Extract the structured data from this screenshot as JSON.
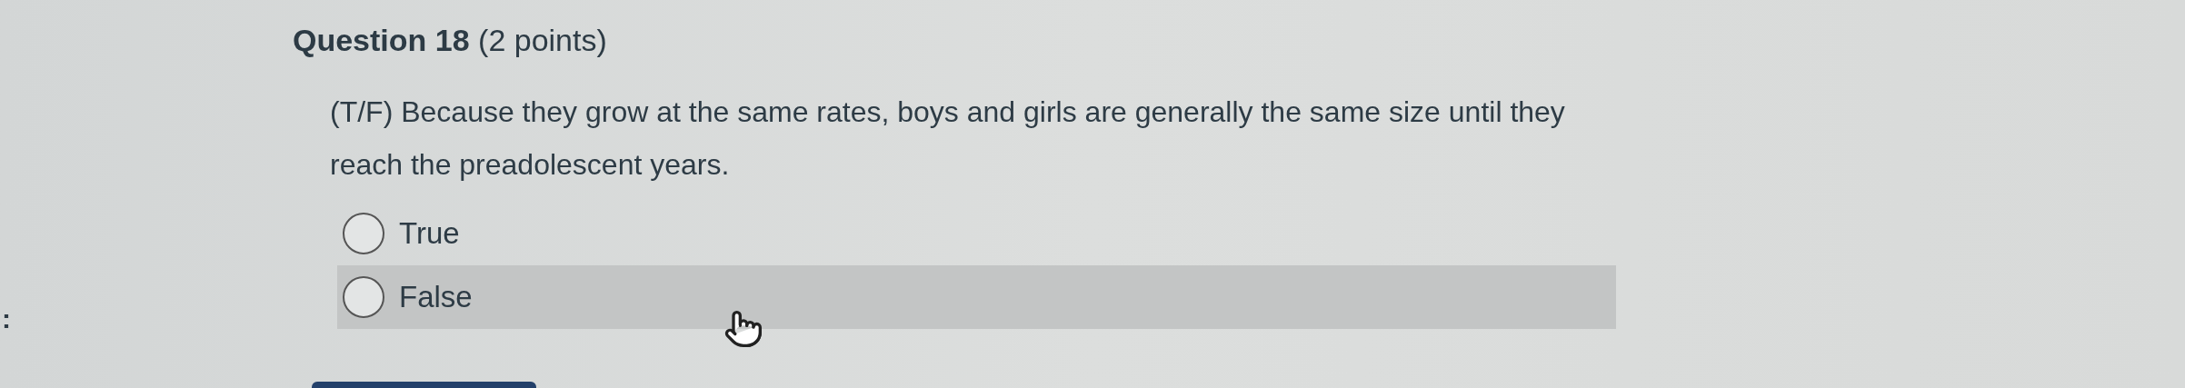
{
  "edge_text": ":",
  "question": {
    "title": "**Question 18** (2 points)",
    "prompt": "(T/F) Because they grow at the same rates, boys and girls are generally the same size until they reach the preadolescent years.",
    "options": [
      {
        "label": "True",
        "selected": false,
        "hovered": false
      },
      {
        "label": "False",
        "selected": false,
        "hovered": true
      }
    ]
  }
}
